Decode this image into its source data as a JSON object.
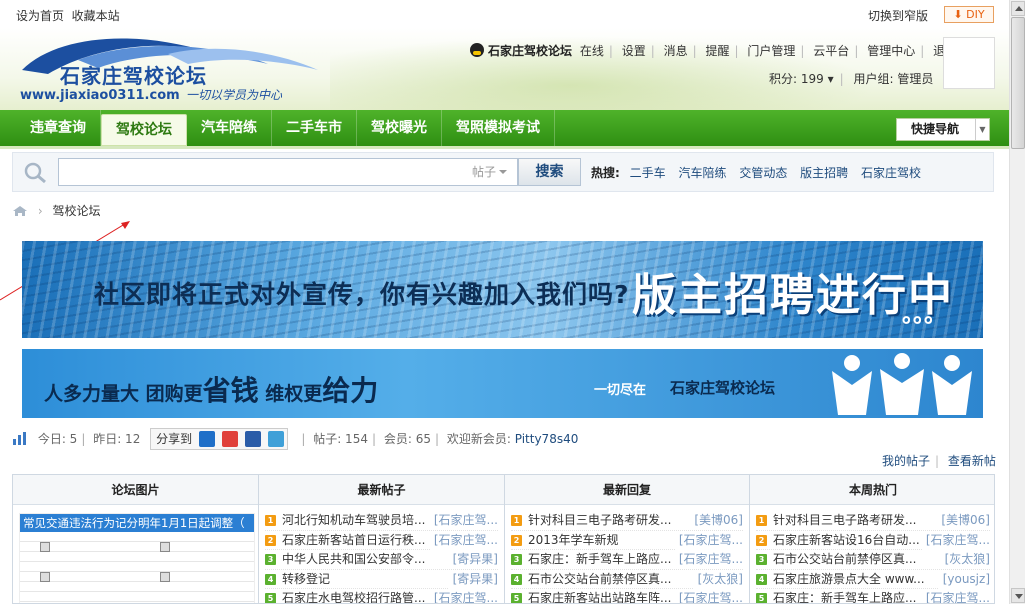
{
  "topbar": {
    "set_home": "设为首页",
    "bookmark": "收藏本站",
    "switch_width": "切换到窄版",
    "diy": "DIY"
  },
  "logo": {
    "name": "石家庄驾校论坛",
    "url": "www.jiaxiao0311.com",
    "slogan": "一切以学员为中心"
  },
  "user": {
    "name": "石家庄驾校论坛",
    "links": [
      "在线",
      "设置",
      "消息",
      "提醒",
      "门户管理",
      "云平台",
      "管理中心",
      "退出"
    ],
    "points": "积分: 199",
    "group": "用户组: 管理员"
  },
  "nav": {
    "items": [
      "违章查询",
      "驾校论坛",
      "汽车陪练",
      "二手车市",
      "驾校曝光",
      "驾照模拟考试"
    ],
    "active_index": 1,
    "quick_nav": "快捷导航"
  },
  "search": {
    "value": "",
    "type": "帖子",
    "button": "搜索",
    "hot_label": "热搜:",
    "hot_words": [
      "二手车",
      "汽车陪练",
      "交管动态",
      "版主招聘",
      "石家庄驾校"
    ]
  },
  "breadcrumb": {
    "current": "驾校论坛"
  },
  "banners": {
    "b1_text": "社区即将正式对外宣传，你有兴趣加入我们吗?",
    "b1_big": "版主招聘进行中",
    "b1_dots": "。。。",
    "b2_part1": "人多力量大  团购更",
    "b2_big1": "省钱",
    "b2_part2": "  维权更",
    "b2_big2": "给力",
    "b2_sub": "一切尽在",
    "b2_name": "石家庄驾校论坛"
  },
  "stats": {
    "today": "今日: 5",
    "yesterday": "昨日: 12",
    "share": "分享到",
    "posts": "帖子: 154",
    "members": "会员: 65",
    "welcome": "欢迎新会员:",
    "new_member": "Pitty78s40",
    "my_posts": "我的帖子",
    "view_new": "查看新帖"
  },
  "colors": {
    "nav_green": "#3a9e1c",
    "link_blue": "#1f4c7e",
    "rank_orange": "#f39c12",
    "rank_green": "#5bb12f"
  },
  "grid": {
    "pic_header": "论坛图片",
    "pic_caption": "常见交通违法行为记分明年1月1日起调整（",
    "columns": [
      {
        "header": "最新帖子",
        "rows": [
          {
            "n": "1",
            "title": "河北行知机动车驾驶员培...",
            "author": "[石家庄驾..."
          },
          {
            "n": "2",
            "title": "石家庄新客站首日运行秩...",
            "author": "[石家庄驾..."
          },
          {
            "n": "3",
            "title": "中华人民共和国公安部令...",
            "author": "[寄异果]"
          },
          {
            "n": "4",
            "title": "转移登记",
            "author": "[寄异果]"
          },
          {
            "n": "5",
            "title": "石家庄水电驾校招行路管...",
            "author": "[石家庄驾..."
          }
        ]
      },
      {
        "header": "最新回复",
        "rows": [
          {
            "n": "1",
            "title": "针对科目三电子路考研发...",
            "author": "[美博06]"
          },
          {
            "n": "2",
            "title": "2013年学车新规",
            "author": "[石家庄驾..."
          },
          {
            "n": "3",
            "title": "石家庄：新手驾车上路应...",
            "author": "[石家庄驾..."
          },
          {
            "n": "4",
            "title": "石市公交站台前禁停区真...",
            "author": "[灰太狼]"
          },
          {
            "n": "5",
            "title": "石家庄新客站出站路车阵...",
            "author": "[石家庄驾..."
          }
        ]
      },
      {
        "header": "本周热门",
        "rows": [
          {
            "n": "1",
            "title": "针对科目三电子路考研发...",
            "author": "[美博06]"
          },
          {
            "n": "2",
            "title": "石家庄新客站设16台自动...",
            "author": "[石家庄驾..."
          },
          {
            "n": "3",
            "title": "石市公交站台前禁停区真...",
            "author": "[灰太狼]"
          },
          {
            "n": "4",
            "title": "石家庄旅游景点大全 www...",
            "author": "[yousjz]"
          },
          {
            "n": "5",
            "title": "石家庄：新手驾车上路应...",
            "author": "[石家庄驾..."
          }
        ]
      }
    ]
  }
}
